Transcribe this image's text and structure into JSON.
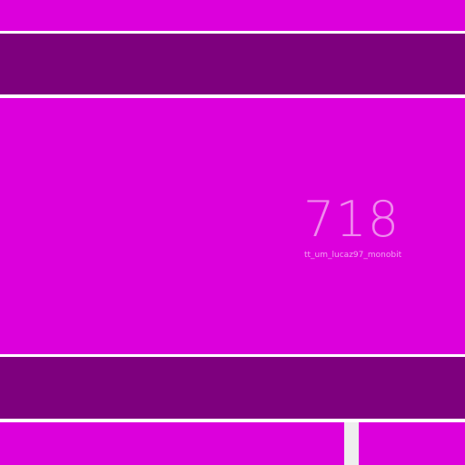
{
  "colors": {
    "bright_tile": "#dc00dc",
    "dark_tile": "#7e007e",
    "divider": "#ffffff",
    "number_text": "#f08aee",
    "caption_text": "#f3a2f2"
  },
  "main_tile": {
    "value": "718",
    "caption": "tt_um_lucaz97_monobit"
  }
}
